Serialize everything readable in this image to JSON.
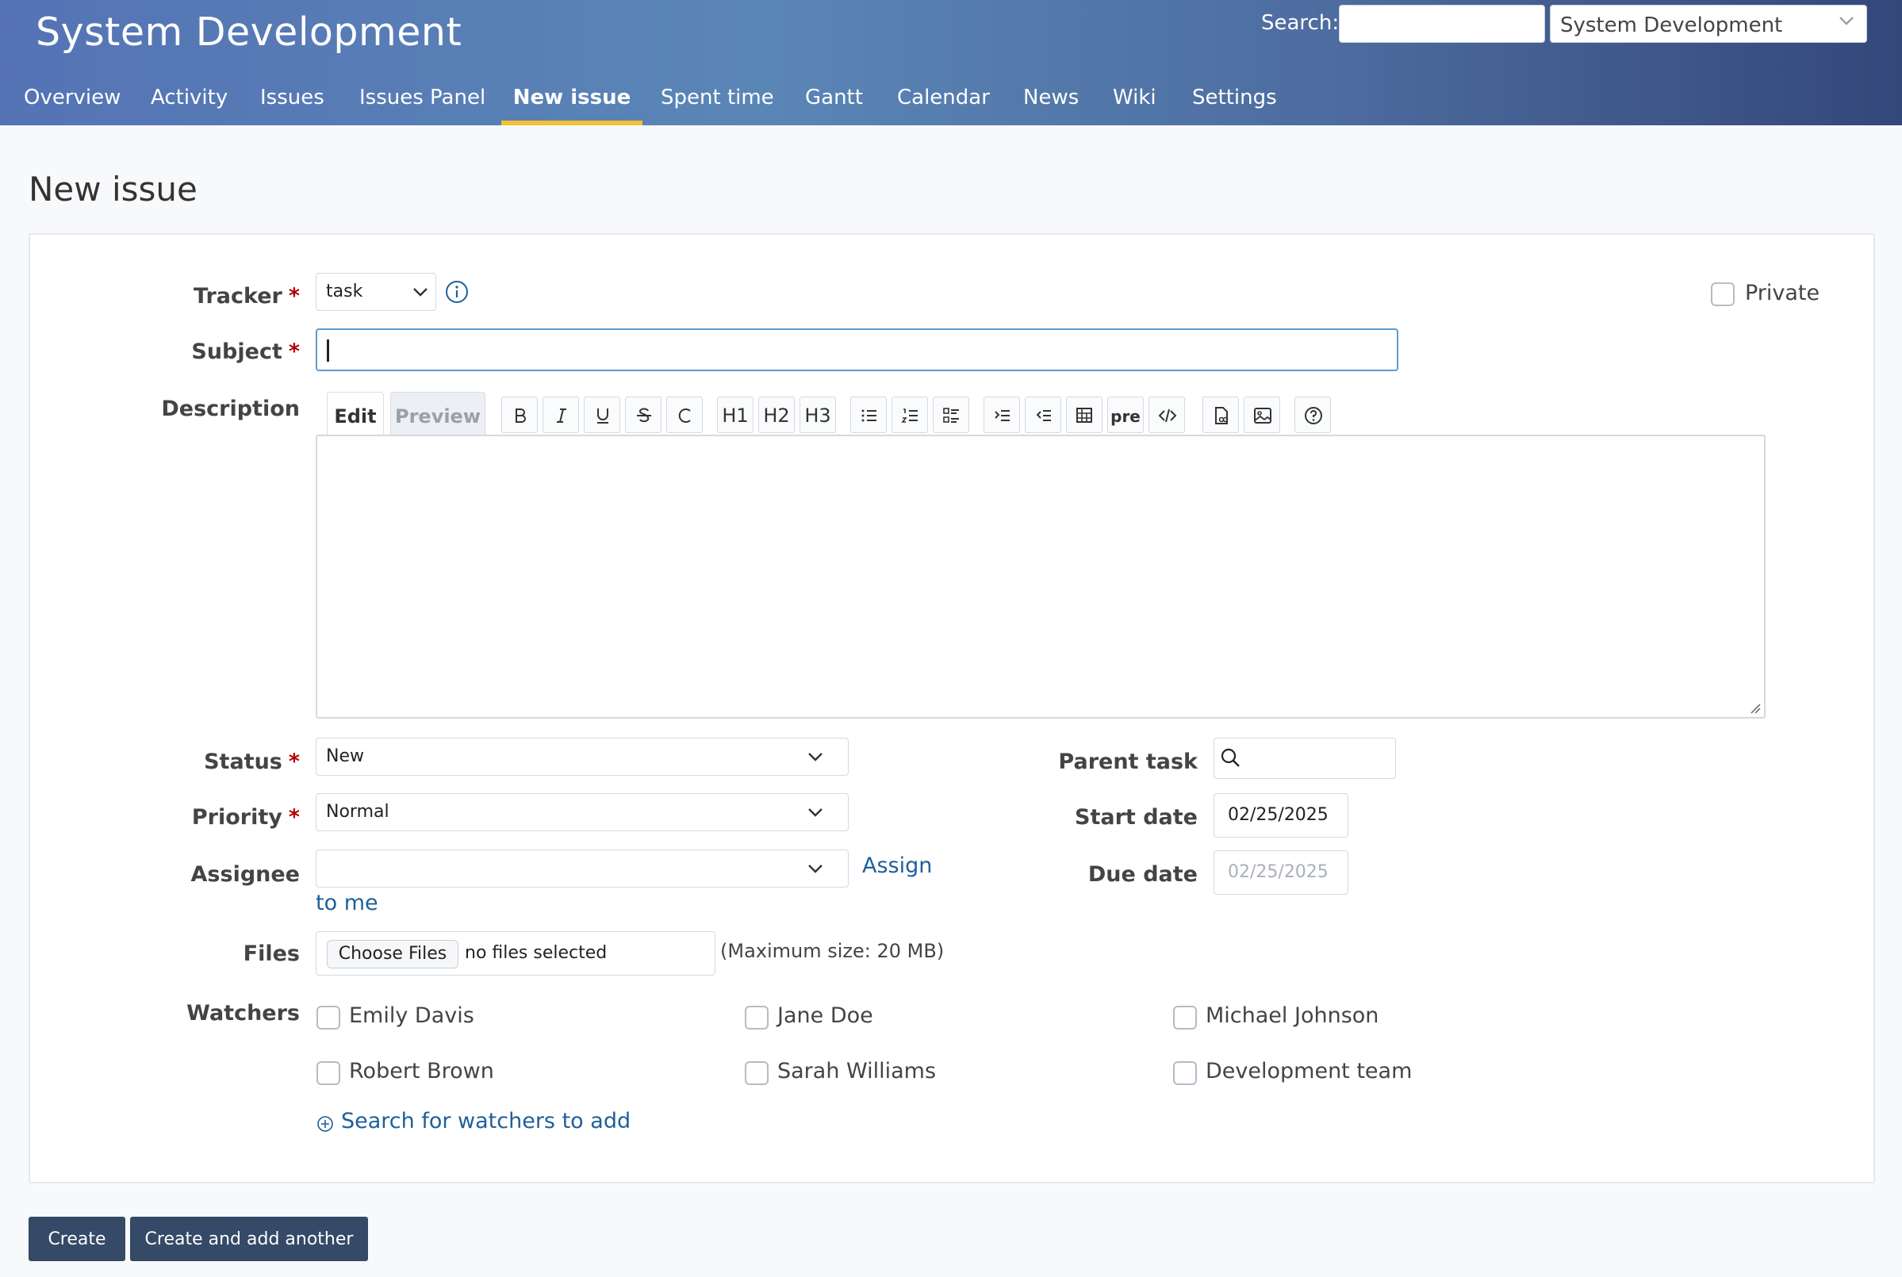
{
  "header": {
    "project_title": "System Development",
    "search_label": "Search:",
    "search_value": "",
    "project_jump_value": "System Development"
  },
  "nav": {
    "items": [
      "Overview",
      "Activity",
      "Issues",
      "Issues Panel",
      "New issue",
      "Spent time",
      "Gantt",
      "Calendar",
      "News",
      "Wiki",
      "Settings"
    ],
    "active": "New issue",
    "accent_color": "#f1c232"
  },
  "page": {
    "title": "New issue"
  },
  "form": {
    "tracker": {
      "label": "Tracker",
      "value": "task",
      "info_icon": "info-icon"
    },
    "private": {
      "label": "Private",
      "checked": false
    },
    "subject": {
      "label": "Subject",
      "value": ""
    },
    "description": {
      "label": "Description",
      "tab_edit": "Edit",
      "tab_preview": "Preview",
      "toolbar": [
        "bold",
        "italic",
        "underline",
        "strikethrough",
        "code",
        "h1",
        "h2",
        "h3",
        "unordered-list",
        "ordered-list",
        "task-list",
        "indent",
        "outdent",
        "table",
        "pre",
        "code-block",
        "attachment-link",
        "image",
        "help"
      ],
      "toolbar_labels": {
        "h1": "H1",
        "h2": "H2",
        "h3": "H3",
        "pre": "pre"
      },
      "value": ""
    },
    "status": {
      "label": "Status",
      "value": "New"
    },
    "priority": {
      "label": "Priority",
      "value": "Normal"
    },
    "assignee": {
      "label": "Assignee",
      "value": "",
      "assign_link_1": "Assign",
      "assign_link_2": "to me"
    },
    "parent_task": {
      "label": "Parent task",
      "value": ""
    },
    "start_date": {
      "label": "Start date",
      "value": "02/25/2025"
    },
    "due_date": {
      "label": "Due date",
      "placeholder": "02/25/2025"
    },
    "files": {
      "label": "Files",
      "button": "Choose Files",
      "status": "no files selected",
      "max_size": "(Maximum size: 20 MB)"
    },
    "watchers": {
      "label": "Watchers",
      "people": [
        "Emily Davis",
        "Jane Doe",
        "Michael Johnson",
        "Robert Brown",
        "Sarah Williams",
        "Development team"
      ],
      "search_link": "Search for watchers to add"
    }
  },
  "buttons": {
    "create": "Create",
    "create_and_add": "Create and add another"
  }
}
